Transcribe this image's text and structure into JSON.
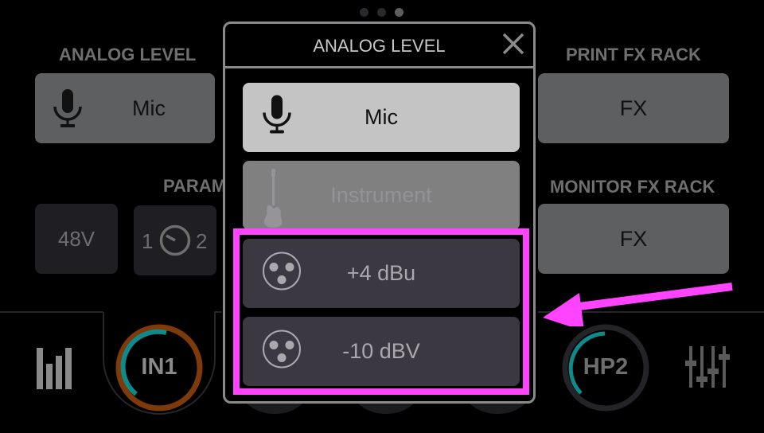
{
  "page_indicator": {
    "total": 3,
    "active_index": 2
  },
  "left_panel": {
    "analog_level": {
      "label": "ANALOG LEVEL",
      "value": "Mic",
      "icon": "microphone-icon"
    },
    "params": {
      "label": "PARAM",
      "phantom_power": {
        "label": "48V"
      },
      "input_select": {
        "left": "1",
        "right": "2",
        "icon": "knob-icon"
      }
    }
  },
  "right_panel": {
    "print_fx_rack": {
      "label": "PRINT FX RACK",
      "button": "FX"
    },
    "monitor_fx_rack": {
      "label": "MONITOR FX RACK",
      "button": "FX"
    }
  },
  "bottom_nav": {
    "meters_icon": "level-meters-icon",
    "channels": [
      {
        "label": "IN1",
        "ring_color": "#7e3a09",
        "level_color": "#0e8a8a",
        "selected": true
      },
      {
        "label": "HP2",
        "ring_color": "#242328",
        "level_color": "#0e8a8a",
        "selected": false
      }
    ],
    "mixer_icon": "mixer-faders-icon"
  },
  "modal": {
    "title": "ANALOG LEVEL",
    "close_icon": "close-icon",
    "options": [
      {
        "label": "Mic",
        "icon": "microphone-icon",
        "state": "selected"
      },
      {
        "label": "Instrument",
        "icon": "guitar-icon",
        "state": "disabled"
      },
      {
        "label": "+4 dBu",
        "icon": "xlr-connector-icon",
        "state": "available"
      },
      {
        "label": "-10 dBV",
        "icon": "xlr-connector-icon",
        "state": "available"
      }
    ]
  },
  "annotation": {
    "color": "#ff44ff",
    "highlight": "line-level-options",
    "arrow": "pointing-left"
  }
}
